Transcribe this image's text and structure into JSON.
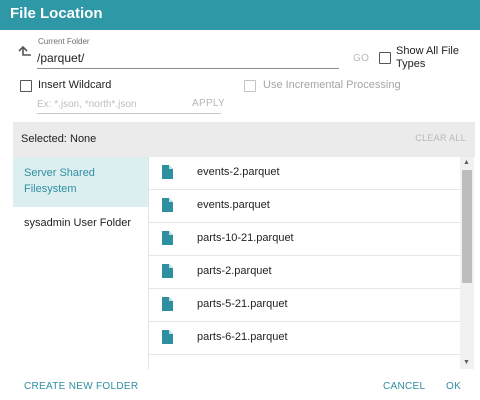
{
  "dialog": {
    "title": "File Location"
  },
  "location": {
    "caption": "Current Folder",
    "path": "/parquet/",
    "go_label": "GO",
    "show_all_file_types": "Show All File Types"
  },
  "wildcard": {
    "label": "Insert Wildcard",
    "placeholder": "Ex: *.json, *north*.json",
    "apply_label": "APPLY",
    "incremental_label": "Use Incremental Processing"
  },
  "selection": {
    "label": "Selected:",
    "value": "None",
    "clear_all_label": "CLEAR ALL"
  },
  "sidebar": {
    "items": [
      {
        "label": "Server Shared Filesystem",
        "active": true
      },
      {
        "label": "sysadmin User Folder",
        "active": false
      }
    ]
  },
  "files": [
    {
      "name": "events-2.parquet"
    },
    {
      "name": "events.parquet"
    },
    {
      "name": "parts-10-21.parquet"
    },
    {
      "name": "parts-2.parquet"
    },
    {
      "name": "parts-5-21.parquet"
    },
    {
      "name": "parts-6-21.parquet"
    }
  ],
  "footer": {
    "create_folder_label": "CREATE NEW FOLDER",
    "cancel_label": "CANCEL",
    "ok_label": "OK"
  },
  "icons": {
    "up": "arrow-up-left-icon",
    "file": "file-icon"
  },
  "colors": {
    "accent": "#2e98a6",
    "sidebar_active_bg": "#ddeef1"
  }
}
